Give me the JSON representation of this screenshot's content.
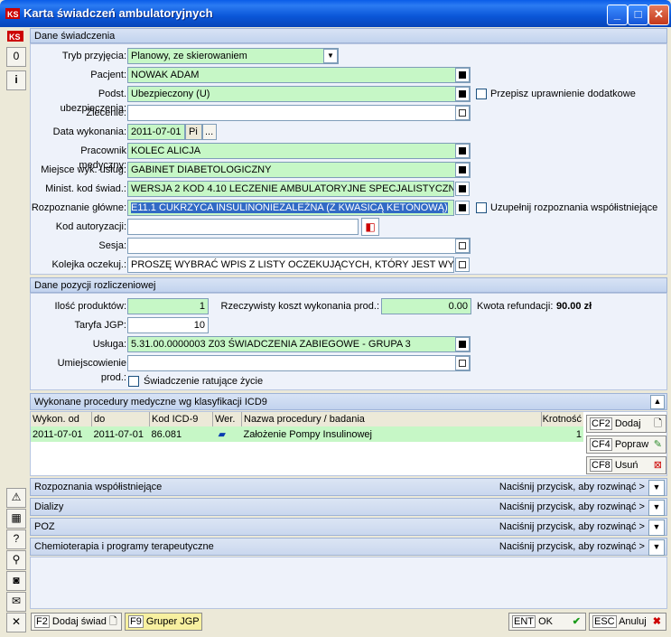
{
  "window": {
    "title": "Karta świadczeń ambulatoryjnych"
  },
  "sections": {
    "dane_swiadczenia": "Dane świadczenia",
    "dane_pozycji": "Dane pozycji rozliczeniowej",
    "procedury": "Wykonane procedury medyczne wg klasyfikacji ICD9"
  },
  "form": {
    "tryb_label": "Tryb przyjęcia:",
    "tryb_value": "Planowy, ze skierowaniem",
    "pacjent_label": "Pacjent:",
    "pacjent_value": "NOWAK ADAM",
    "podst_label": "Podst. ubezpieczenia:",
    "podst_value": "Ubezpieczony (U)",
    "przepisz_label": "Przepisz uprawnienie dodatkowe",
    "zlecenie_label": "Zlecenie:",
    "zlecenie_value": "",
    "data_label": "Data wykonania:",
    "data_value": "2011-07-01",
    "data_day": "Pi",
    "data_btn": "...",
    "pracownik_label": "Pracownik medyczny:",
    "pracownik_value": "KOLEC ALICJA",
    "miejsce_label": "Miejsce wyk. usług:",
    "miejsce_value": "GABINET DIABETOLOGICZNY",
    "minist_label": "Minist. kod świad.:",
    "minist_value": "WERSJA 2 KOD 4.10 LECZENIE AMBULATORYJNE SPECJALISTYCZN",
    "rozpoznanie_label": "Rozpoznanie główne:",
    "rozpoznanie_value": "E11.1 CUKRZYCA INSULINONIEZALEŻNA (Z KWASICĄ KETONOWĄ)",
    "uzupelnij_label": "Uzupełnij rozpoznania współistniejące",
    "kod_label": "Kod autoryzacji:",
    "kod_value": "",
    "sesja_label": "Sesja:",
    "sesja_value": "",
    "kolejka_label": "Kolejka oczekuj.:",
    "kolejka_value": "PROSZĘ WYBRAĆ WPIS Z LISTY OCZEKUJĄCYCH, KTÓRY JEST WY"
  },
  "pozycja": {
    "ilosc_label": "Ilość produktów:",
    "ilosc_value": "1",
    "koszt_label": "Rzeczywisty koszt wykonania prod.:",
    "koszt_value": "0.00",
    "kwota_label": "Kwota refundacji:",
    "kwota_value": "90.00 zł",
    "taryfa_label": "Taryfa JGP:",
    "taryfa_value": "10",
    "usluga_label": "Usługa:",
    "usluga_value": "5.31.00.0000003 Z03 ŚWIADCZENIA ZABIEGOWE - GRUPA 3",
    "umiejsc_label": "Umiejscowienie prod.:",
    "umiejsc_value": "",
    "ratujace_label": "Świadczenie ratujące życie"
  },
  "table": {
    "headers": [
      "Wykon. od",
      "do",
      "Kod ICD-9",
      "Wer.",
      "Nazwa procedury / badania",
      "Krotność"
    ],
    "rows": [
      [
        "2011-07-01",
        "2011-07-01",
        "86.081",
        "",
        "Założenie Pompy Insulinowej",
        "1"
      ]
    ]
  },
  "side_buttons": {
    "dodaj_key": "CF2",
    "dodaj": "Dodaj",
    "popraw_key": "CF4",
    "popraw": "Popraw",
    "usun_key": "CF8",
    "usun": "Usuń"
  },
  "collapsibles": [
    {
      "title": "Rozpoznania współistniejące",
      "hint": "Naciśnij przycisk, aby rozwinąć >"
    },
    {
      "title": "Dializy",
      "hint": "Naciśnij przycisk, aby rozwinąć >"
    },
    {
      "title": "POZ",
      "hint": "Naciśnij przycisk, aby rozwinąć >"
    },
    {
      "title": "Chemioterapia i programy terapeutyczne",
      "hint": "Naciśnij przycisk, aby rozwinąć >"
    }
  ],
  "bottom": {
    "f2_key": "F2",
    "f2": "Dodaj świad",
    "f9_key": "F9",
    "f9": "Gruper JGP",
    "ok_key": "ENT",
    "ok": "OK",
    "esc_key": "ESC",
    "esc": "Anuluj"
  },
  "lefttool": {
    "zero": "0",
    "info": "i",
    "help": "?"
  },
  "titlebar": {
    "min": "_",
    "max": "□",
    "close": "✕"
  },
  "colors": {
    "field_green": "#c6f7c6",
    "title_blue": "#0a56d8"
  }
}
